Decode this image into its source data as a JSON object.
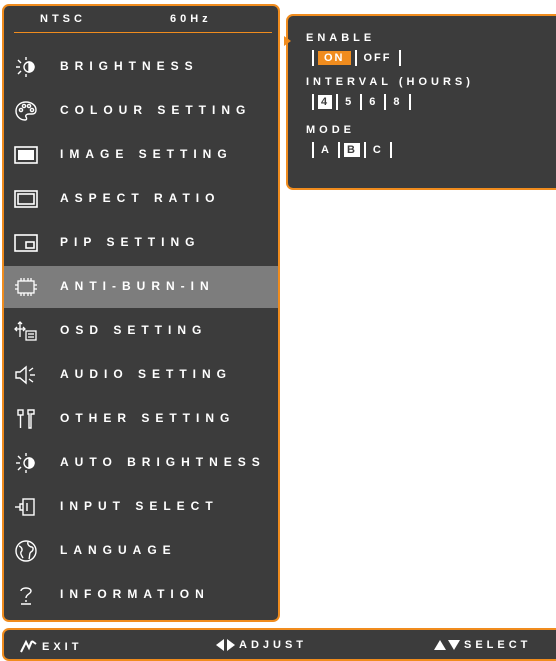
{
  "header": {
    "signal": "NTSC",
    "refresh": "60Hz"
  },
  "menu": {
    "items": [
      {
        "label": "BRIGHTNESS",
        "icon": "brightness-icon"
      },
      {
        "label": "COLOUR SETTING",
        "icon": "palette-icon"
      },
      {
        "label": "IMAGE SETTING",
        "icon": "image-icon"
      },
      {
        "label": "ASPECT RATIO",
        "icon": "aspect-ratio-icon"
      },
      {
        "label": "PIP SETTING",
        "icon": "pip-icon"
      },
      {
        "label": "ANTI-BURN-IN",
        "icon": "chip-icon",
        "selected": true
      },
      {
        "label": "OSD SETTING",
        "icon": "osd-icon"
      },
      {
        "label": "AUDIO SETTING",
        "icon": "speaker-icon"
      },
      {
        "label": "OTHER SETTING",
        "icon": "tools-icon"
      },
      {
        "label": "AUTO BRIGHTNESS",
        "icon": "auto-brightness-icon"
      },
      {
        "label": "INPUT SELECT",
        "icon": "input-plug-icon"
      },
      {
        "label": "LANGUAGE",
        "icon": "globe-icon"
      },
      {
        "label": "INFORMATION",
        "icon": "question-icon"
      }
    ]
  },
  "submenu": {
    "enable": {
      "title": "ENABLE",
      "options": [
        "ON",
        "OFF"
      ],
      "selected": "ON"
    },
    "interval": {
      "title": "INTERVAL (HOURS)",
      "options": [
        "4",
        "5",
        "6",
        "8"
      ],
      "selected": "4"
    },
    "mode": {
      "title": "MODE",
      "options": [
        "A",
        "B",
        "C"
      ],
      "selected": "B"
    }
  },
  "footer": {
    "exit": "EXIT",
    "adjust": "ADJUST",
    "select": "SELECT"
  },
  "colors": {
    "accent": "#f08c1e",
    "panel": "#3c3c3c",
    "selected_row": "#7d7d7d"
  }
}
